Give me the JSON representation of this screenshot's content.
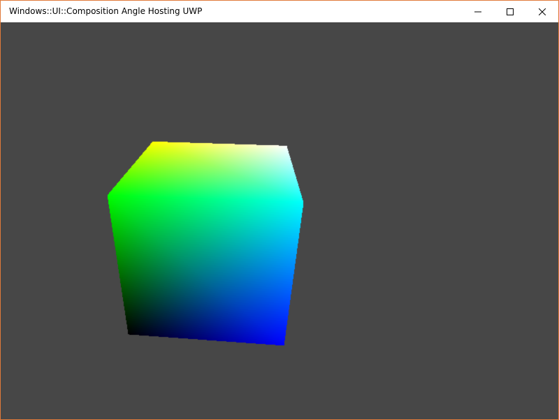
{
  "window": {
    "title": "Windows::UI::Composition Angle Hosting UWP",
    "border_color": "#e07a3a",
    "titlebar_color": "#ffffff",
    "client_background": "#474747"
  },
  "controls": {
    "minimize_icon": "minimize-icon",
    "maximize_icon": "maximize-icon",
    "close_icon": "close-icon"
  },
  "scene": {
    "object": "rgb-color-cube",
    "corner_colors": {
      "top_back_left": "#ffff00",
      "top_back_right": "#ffffff",
      "front_top_left": "#00ff00",
      "front_top_right": "#00ffff",
      "front_bottom_left": "#000000",
      "front_bottom_right": "#0000ff"
    }
  }
}
